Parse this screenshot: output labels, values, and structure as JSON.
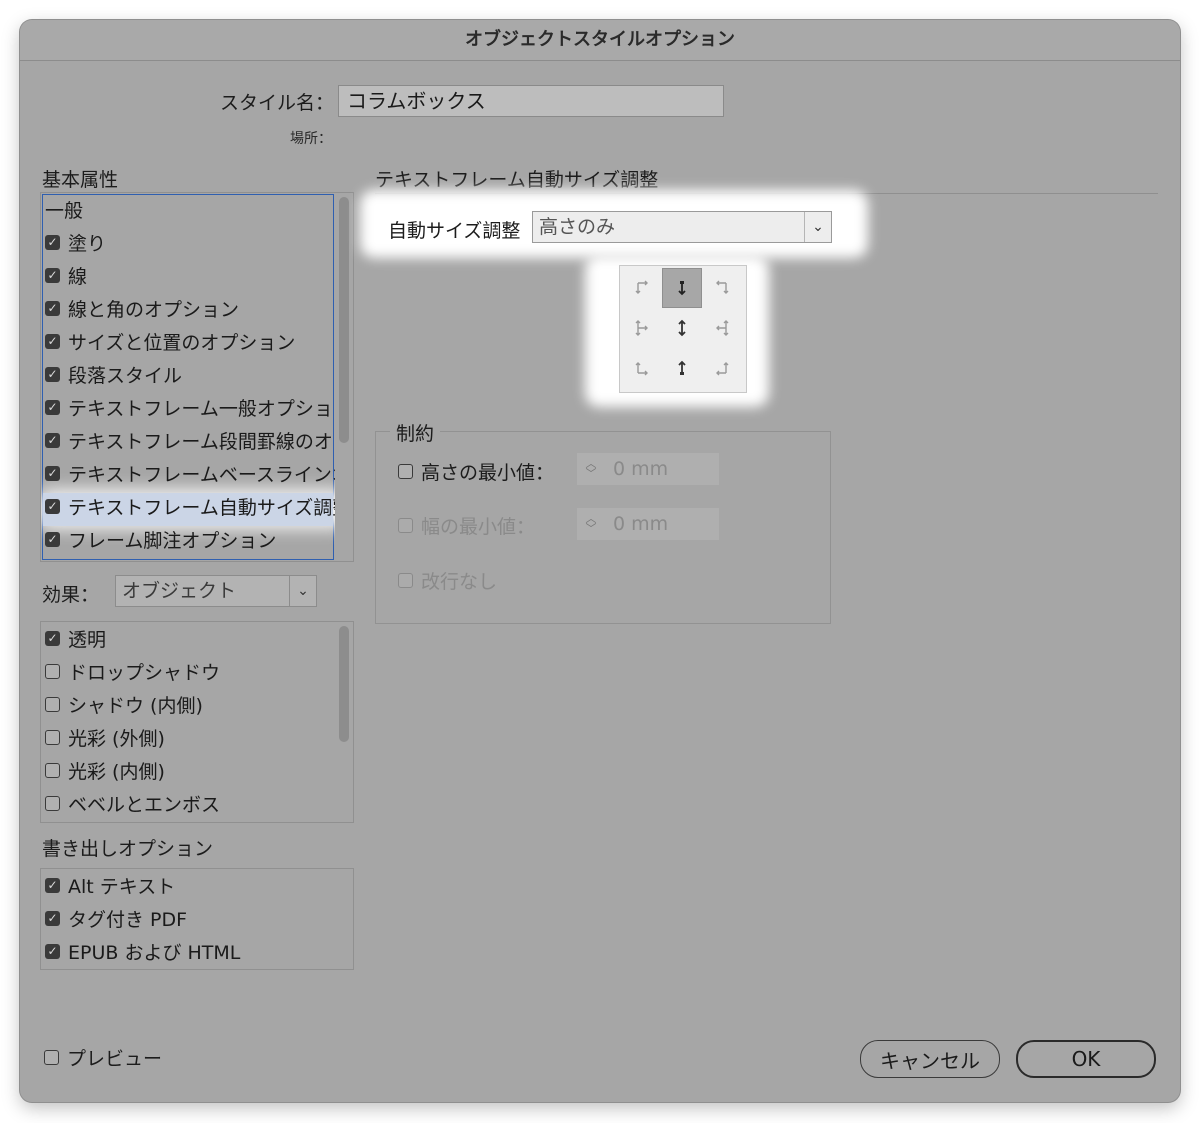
{
  "dialog": {
    "title": "オブジェクトスタイルオプション"
  },
  "style_name": {
    "label": "スタイル名：",
    "value": "コラムボックス",
    "location_label": "場所："
  },
  "basic_attributes": {
    "heading": "基本属性",
    "items": [
      {
        "label": "一般",
        "checkbox": false
      },
      {
        "label": "塗り",
        "checkbox": true
      },
      {
        "label": "線",
        "checkbox": true
      },
      {
        "label": "線と角のオプション",
        "checkbox": true
      },
      {
        "label": "サイズと位置のオプション",
        "checkbox": true
      },
      {
        "label": "段落スタイル",
        "checkbox": true
      },
      {
        "label": "テキストフレーム一般オプション",
        "checkbox": true
      },
      {
        "label": "テキストフレーム段間罫線のオプション",
        "checkbox": true
      },
      {
        "label": "テキストフレームベースラインオプション",
        "checkbox": true
      },
      {
        "label": "テキストフレーム自動サイズ調整",
        "checkbox": true,
        "selected": true
      },
      {
        "label": "フレーム脚注オプション",
        "checkbox": true
      }
    ]
  },
  "effects": {
    "label": "効果：",
    "target": "オブジェクト",
    "items": [
      {
        "label": "透明",
        "checked": true
      },
      {
        "label": "ドロップシャドウ",
        "checked": false
      },
      {
        "label": "シャドウ (内側)",
        "checked": false
      },
      {
        "label": "光彩 (外側)",
        "checked": false
      },
      {
        "label": "光彩 (内側)",
        "checked": false
      },
      {
        "label": "ベベルとエンボス",
        "checked": false
      }
    ]
  },
  "export_options": {
    "heading": "書き出しオプション",
    "items": [
      {
        "label": "Alt テキスト",
        "checked": true
      },
      {
        "label": "タグ付き PDF",
        "checked": true
      },
      {
        "label": "EPUB および HTML",
        "checked": true
      }
    ]
  },
  "panel": {
    "heading": "テキストフレーム自動サイズ調整",
    "auto_size_label": "自動サイズ調整",
    "auto_size_value": "高さのみ",
    "reference_point_selected": "top-center"
  },
  "constraints": {
    "heading": "制約",
    "min_height_label": "高さの最小値：",
    "min_height_value": "0 mm",
    "min_width_label": "幅の最小値：",
    "min_width_value": "0 mm",
    "no_line_break_label": "改行なし"
  },
  "footer": {
    "preview_label": "プレビュー",
    "cancel_label": "キャンセル",
    "ok_label": "OK"
  }
}
